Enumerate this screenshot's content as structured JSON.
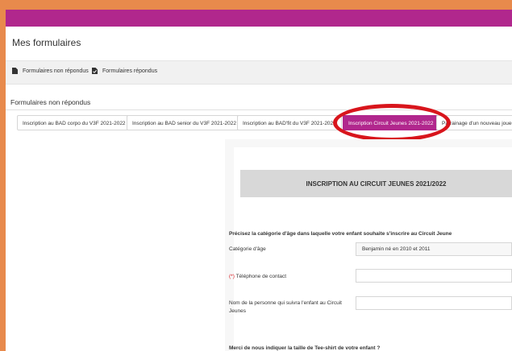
{
  "page": {
    "title": "Mes formulaires"
  },
  "tabs": [
    {
      "label": "Formulaires non répondus",
      "icon": "file-icon"
    },
    {
      "label": "Formulaires répondus",
      "icon": "file-check-icon"
    }
  ],
  "section": {
    "title": "Formulaires non répondus"
  },
  "forms": [
    {
      "label": "Inscription au BAD corpo du V3F 2021-2022",
      "active": false
    },
    {
      "label": "Inscription au BAD senior du V3F 2021-2022",
      "active": false
    },
    {
      "label": "Inscription au BAD'fit du V3F 2021-2022",
      "active": false
    },
    {
      "label": "Inscription Circuit Jeunes 2021-2022",
      "active": true
    },
    {
      "label": "Parrainage d'un nouveau joueur",
      "active": false
    }
  ],
  "form": {
    "header": "INSCRIPTION AU CIRCUIT JEUNES 2021/2022",
    "q1": "Précisez la catégorie d'âge dans laquelle votre enfant souhaite s'inscrire au Circuit Jeune",
    "age_label": "Catégorie d'âge",
    "age_value": "Benjamin né en 2010 et 2011",
    "required_mark": "(*)",
    "phone_label": "Téléphone de contact",
    "phone_value": "",
    "person_label": "Nom de la personne qui suivra l'enfant au Circuit Jeunes",
    "person_value": "",
    "q2": "Merci de nous indiquer la taille de Tee-shirt de votre enfant ?"
  },
  "colors": {
    "brand": "#b1278d",
    "highlight": "#d8151c",
    "page_bg": "#e88a4c"
  }
}
